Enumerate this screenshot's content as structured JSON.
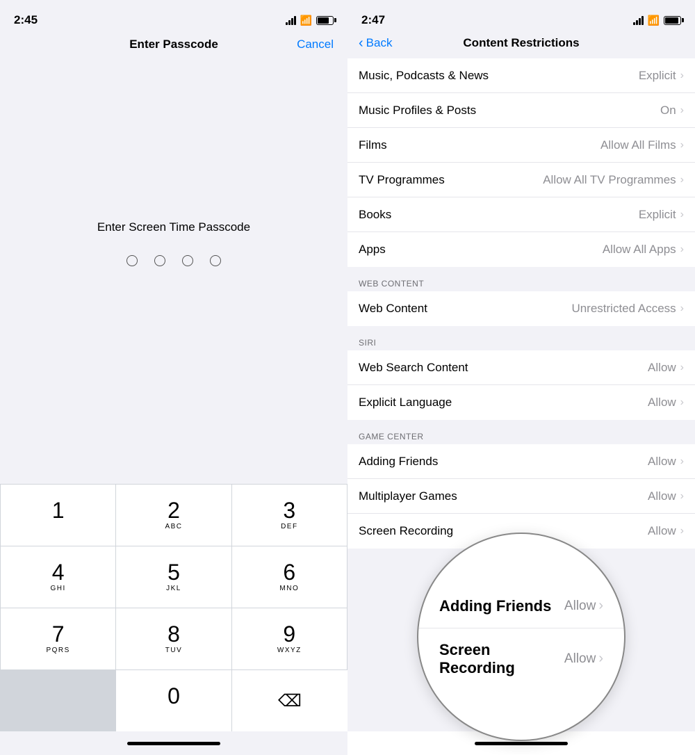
{
  "leftPanel": {
    "statusBar": {
      "time": "2:45"
    },
    "navBar": {
      "title": "Enter Passcode",
      "cancelLabel": "Cancel"
    },
    "passcode": {
      "label": "Enter Screen Time Passcode",
      "dots": 4
    },
    "keypad": [
      {
        "number": "1",
        "letters": ""
      },
      {
        "number": "2",
        "letters": "ABC"
      },
      {
        "number": "3",
        "letters": "DEF"
      },
      {
        "number": "4",
        "letters": "GHI"
      },
      {
        "number": "5",
        "letters": "JKL"
      },
      {
        "number": "6",
        "letters": "MNO"
      },
      {
        "number": "7",
        "letters": "PQRS"
      },
      {
        "number": "8",
        "letters": "TUV"
      },
      {
        "number": "9",
        "letters": "WXYZ"
      },
      {
        "number": "0",
        "letters": ""
      }
    ]
  },
  "rightPanel": {
    "statusBar": {
      "time": "2:47"
    },
    "navBar": {
      "backLabel": "Back",
      "title": "Content Restrictions"
    },
    "rows": [
      {
        "label": "Music, Podcasts & News",
        "value": "Explicit"
      },
      {
        "label": "Music Profiles & Posts",
        "value": "On"
      },
      {
        "label": "Films",
        "value": "Allow All Films"
      },
      {
        "label": "TV Programmes",
        "value": "Allow All TV Programmes"
      },
      {
        "label": "Books",
        "value": "Explicit"
      },
      {
        "label": "Apps",
        "value": "Allow All Apps"
      }
    ],
    "webContentSection": {
      "header": "WEB CONTENT",
      "rows": [
        {
          "label": "Web Content",
          "value": "Unrestricted Access"
        }
      ]
    },
    "siriSection": {
      "header": "SIRI",
      "rows": [
        {
          "label": "Web Search Content",
          "value": "Allow"
        },
        {
          "label": "Explicit Language",
          "value": "Allow"
        }
      ]
    },
    "gameCenterSection": {
      "header": "GAME CENTER",
      "rows": [
        {
          "label": "Adding Friends",
          "value": "Allow"
        },
        {
          "label": "Multiplayer Games",
          "value": "Allow"
        },
        {
          "label": "Screen Recording",
          "value": "Allow"
        }
      ]
    }
  },
  "magnifiedContent": {
    "rows": [
      {
        "label": "Adding Friends",
        "value": "Allow"
      },
      {
        "label": "Screen Recording",
        "value": "Allow"
      }
    ]
  }
}
